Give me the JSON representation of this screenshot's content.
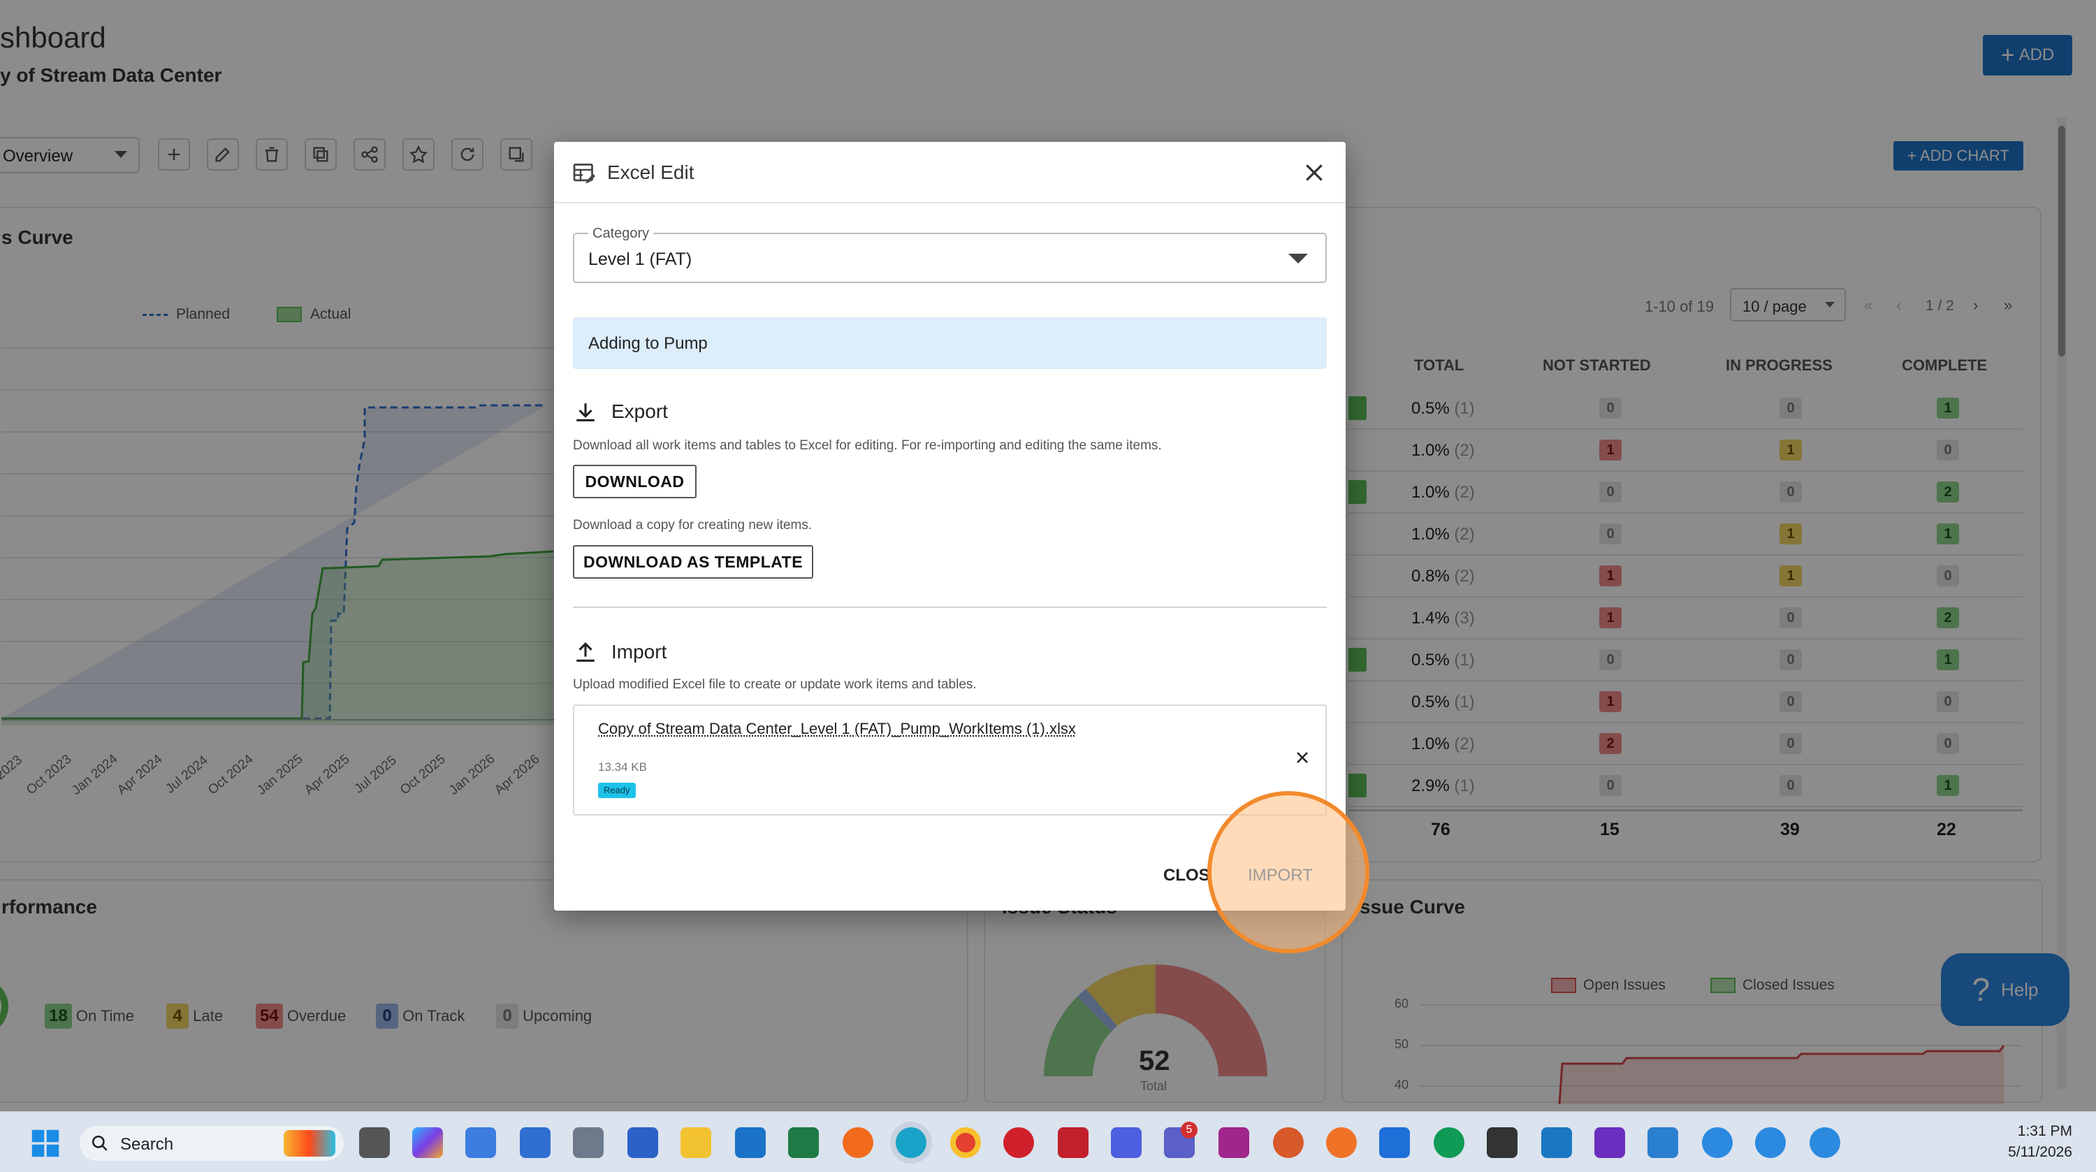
{
  "header": {
    "title": "shboard",
    "subtitle": "y of Stream Data Center",
    "add_label": "ADD"
  },
  "toolbar": {
    "view_select_value": "Overview",
    "add_chart_label": "+ ADD CHART"
  },
  "curve_panel": {
    "title": "s Curve",
    "legend": [
      "Planned",
      "Actual"
    ],
    "x_ticks": [
      "2023",
      "Oct 2023",
      "Jan 2024",
      "Apr 2024",
      "Jul 2024",
      "Oct 2024",
      "Jan 2025",
      "Apr 2025",
      "Jul 2025",
      "Oct 2025",
      "Jan 2026",
      "Apr 2026"
    ]
  },
  "table_panel": {
    "pagination_text": "1-10 of 19",
    "page_size": "10 / page",
    "page_indicator": "1 / 2",
    "nav_first": "«",
    "nav_prev": "‹",
    "nav_next": "›",
    "nav_last": "»",
    "columns": [
      "TOTAL",
      "NOT STARTED",
      "IN PROGRESS",
      "COMPLETE"
    ],
    "rows": [
      {
        "pct": "0.5%",
        "count": "(1)",
        "not_started": "0",
        "in_progress": "0",
        "complete": "1"
      },
      {
        "pct": "1.0%",
        "count": "(2)",
        "not_started": "1",
        "in_progress": "1",
        "complete": "0"
      },
      {
        "pct": "1.0%",
        "count": "(2)",
        "not_started": "0",
        "in_progress": "0",
        "complete": "2"
      },
      {
        "pct": "1.0%",
        "count": "(2)",
        "not_started": "0",
        "in_progress": "1",
        "complete": "1"
      },
      {
        "pct": "0.8%",
        "count": "(2)",
        "not_started": "1",
        "in_progress": "1",
        "complete": "0"
      },
      {
        "pct": "1.4%",
        "count": "(3)",
        "not_started": "1",
        "in_progress": "0",
        "complete": "2"
      },
      {
        "pct": "0.5%",
        "count": "(1)",
        "not_started": "0",
        "in_progress": "0",
        "complete": "1"
      },
      {
        "pct": "0.5%",
        "count": "(1)",
        "not_started": "1",
        "in_progress": "0",
        "complete": "0"
      },
      {
        "pct": "1.0%",
        "count": "(2)",
        "not_started": "2",
        "in_progress": "0",
        "complete": "0"
      },
      {
        "pct": "2.9%",
        "count": "(1)",
        "not_started": "0",
        "in_progress": "0",
        "complete": "1"
      }
    ],
    "totals": [
      "76",
      "15",
      "39",
      "22"
    ]
  },
  "performance_panel": {
    "title": "rformance",
    "stats": [
      {
        "value": "18",
        "label": "On Time"
      },
      {
        "value": "4",
        "label": "Late"
      },
      {
        "value": "54",
        "label": "Overdue"
      },
      {
        "value": "0",
        "label": "On Track"
      },
      {
        "value": "0",
        "label": "Upcoming"
      }
    ]
  },
  "issue_status_panel": {
    "title": "Issue Status",
    "total_value": "52",
    "total_label": "Total"
  },
  "issue_curve_panel": {
    "title": "ssue Curve",
    "legend": [
      "Open Issues",
      "Closed Issues"
    ],
    "y_ticks": [
      "60",
      "50",
      "40"
    ]
  },
  "help_label": "Help",
  "modal": {
    "title": "Excel Edit",
    "category_label": "Category",
    "category_value": "Level 1 (FAT)",
    "info_text": "Adding to Pump",
    "export_heading": "Export",
    "export_desc": "Download all work items and tables to Excel for editing. For re-importing and editing the same items.",
    "download_label": "DOWNLOAD",
    "template_desc": "Download a copy for creating new items.",
    "download_template_label": "DOWNLOAD AS TEMPLATE",
    "import_heading": "Import",
    "import_desc": "Upload modified Excel file to create or update work items and tables.",
    "file_name": "Copy of Stream Data Center_Level 1 (FAT)_Pump_WorkItems (1).xlsx",
    "file_size": "13.34 KB",
    "file_status": "Ready",
    "close_label": "CLOS",
    "import_label": "IMPORT"
  },
  "taskbar": {
    "search_placeholder": "Search",
    "clock_time": "1:31 PM",
    "clock_date": "5/11/2026",
    "teams_badge": "5"
  }
}
